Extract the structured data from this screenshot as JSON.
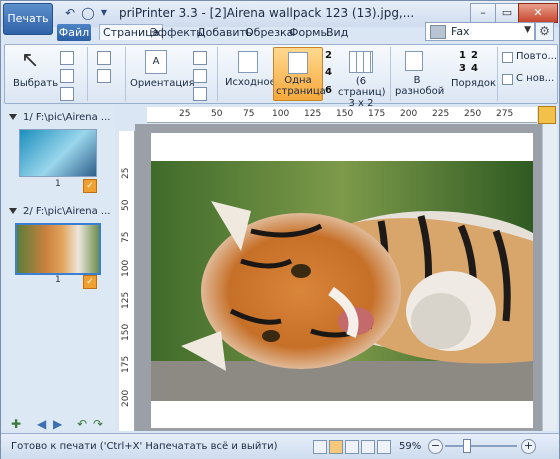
{
  "titlebar": {
    "print_button": "Печать",
    "title": "priPrinter 3.3 - [2]Airena wallpack 123 (13).jpg,...",
    "minimize": "–",
    "maximize": "▭",
    "close": "✕"
  },
  "menu": {
    "file": "Файл",
    "tabs": [
      "Страница",
      "Эффекты",
      "Добавить",
      "Обрезка",
      "Формы",
      "Вид"
    ],
    "active_tab": "Страница"
  },
  "printer": {
    "name": "Fax"
  },
  "ribbon": {
    "select_label": "Выбрать",
    "orientation_label": "Ориентация",
    "original_label": "Исходное",
    "one_page_label": "Одна страница",
    "six_pages_label": "(6 страниц) 3 x 2",
    "numbers_col1": [
      "2",
      "4",
      "6"
    ],
    "mixed_label": "В разнобой",
    "order_label": "Порядок",
    "order_nums": [
      "1",
      "2",
      "3",
      "4"
    ],
    "repeat_label": "Повто...",
    "from_label": "С нов..."
  },
  "pages_panel": {
    "items": [
      {
        "header": "1/ F:\\pic\\Airena ...",
        "page_no": "1"
      },
      {
        "header": "2/ F:\\pic\\Airena ...",
        "page_no": "1"
      }
    ]
  },
  "ruler": {
    "h_ticks": [
      "25",
      "50",
      "75",
      "100",
      "125",
      "150",
      "175",
      "200",
      "225",
      "250",
      "275"
    ],
    "v_ticks": [
      "25",
      "50",
      "75",
      "100",
      "125",
      "150",
      "175",
      "200"
    ]
  },
  "status": {
    "text": "Готово к печати ('Ctrl+X' Напечатать всё и выйти)",
    "zoom": "59%"
  },
  "colors": {
    "accent": "#2f63a8",
    "active_button": "#f6a83a"
  }
}
